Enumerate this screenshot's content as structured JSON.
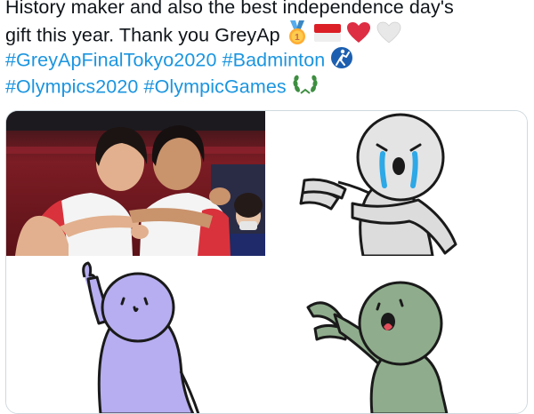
{
  "tweet": {
    "line1": "History maker and also the best independence day's",
    "line2": "gift this year. Thank you GreyAp",
    "hashtags_line1": "#GreyApFinalTokyo2020 #Badminton",
    "hashtags_line2": "#Olympics2020 #OlympicGames",
    "emojis": [
      "gold-medal",
      "indonesia-flag",
      "red-heart",
      "white-heart",
      "badminton",
      "olympic-laurel"
    ]
  },
  "media": {
    "photo": "badminton players celebrating",
    "stickers": [
      "crying character",
      "purple character",
      "green character"
    ]
  },
  "colors": {
    "hashtag": "#1b95e0",
    "text": "#0f1419",
    "border": "#cfd9de"
  }
}
